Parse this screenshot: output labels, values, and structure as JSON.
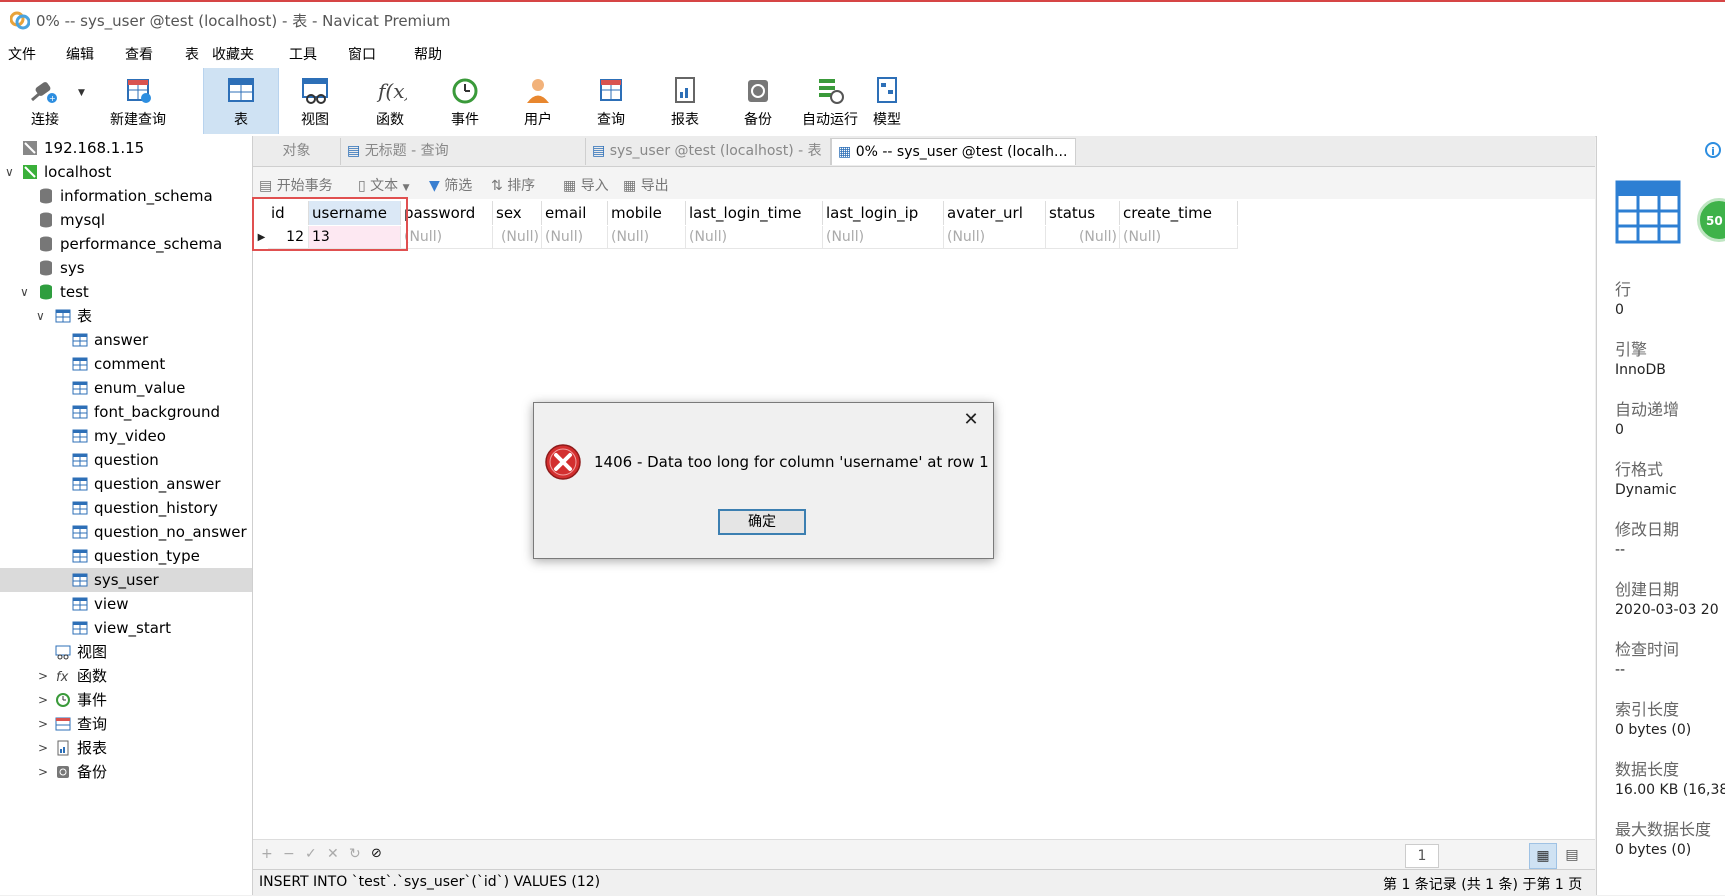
{
  "window": {
    "title": "0% -- sys_user @test (localhost) - 表 - Navicat Premium"
  },
  "menu": [
    "文件",
    "编辑",
    "查看",
    "表",
    "收藏夹",
    "工具",
    "窗口",
    "帮助"
  ],
  "toolbar": {
    "connect": "连接",
    "new_query": "新建查询",
    "table": "表",
    "view": "视图",
    "function": "函数",
    "event": "事件",
    "user": "用户",
    "query": "查询",
    "report": "报表",
    "backup": "备份",
    "autorun": "自动运行",
    "model": "模型"
  },
  "tree": {
    "server_remote": "192.168.1.15",
    "server_local": "localhost",
    "databases": [
      "information_schema",
      "mysql",
      "performance_schema",
      "sys",
      "test"
    ],
    "tables_group": "表",
    "tables": [
      "answer",
      "comment",
      "enum_value",
      "font_background",
      "my_video",
      "question",
      "question_answer",
      "question_history",
      "question_no_answer",
      "question_type",
      "sys_user",
      "view",
      "view_start"
    ],
    "groups": [
      "视图",
      "函数",
      "事件",
      "查询",
      "报表",
      "备份"
    ]
  },
  "tabs": [
    "对象",
    "无标题 - 查询",
    "sys_user @test (localhost) - 表",
    "0% -- sys_user @test (localh..."
  ],
  "subtoolbar": {
    "begin_tx": "开始事务",
    "text": "文本",
    "filter": "筛选",
    "sort": "排序",
    "import": "导入",
    "export": "导出"
  },
  "grid": {
    "columns": [
      "id",
      "username",
      "password",
      "sex",
      "email",
      "mobile",
      "last_login_time",
      "last_login_ip",
      "avater_url",
      "status",
      "create_time"
    ],
    "row": {
      "id": "12",
      "username": "13",
      "null_text": "(Null)"
    }
  },
  "status": {
    "sql": "INSERT INTO `test`.`sys_user`(`id`) VALUES (12)",
    "page": "1",
    "records": "第 1 条记录 (共 1 条) 于第 1 页"
  },
  "panel": {
    "badge": "50",
    "props": [
      {
        "label": "行",
        "value": "0"
      },
      {
        "label": "引擎",
        "value": "InnoDB"
      },
      {
        "label": "自动递增",
        "value": "0"
      },
      {
        "label": "行格式",
        "value": "Dynamic"
      },
      {
        "label": "修改日期",
        "value": "--"
      },
      {
        "label": "创建日期",
        "value": "2020-03-03 20"
      },
      {
        "label": "检查时间",
        "value": "--"
      },
      {
        "label": "索引长度",
        "value": "0 bytes (0)"
      },
      {
        "label": "数据长度",
        "value": "16.00 KB (16,38"
      },
      {
        "label": "最大数据长度",
        "value": "0 bytes (0)"
      }
    ]
  },
  "dialog": {
    "message": "1406 - Data too long for column 'username' at row 1",
    "ok": "确定"
  },
  "colors": {
    "accent": "#3c7fb1",
    "error": "#d32f2f",
    "active_tool": "#cfe2f3",
    "highlight_red": "#e05050"
  }
}
